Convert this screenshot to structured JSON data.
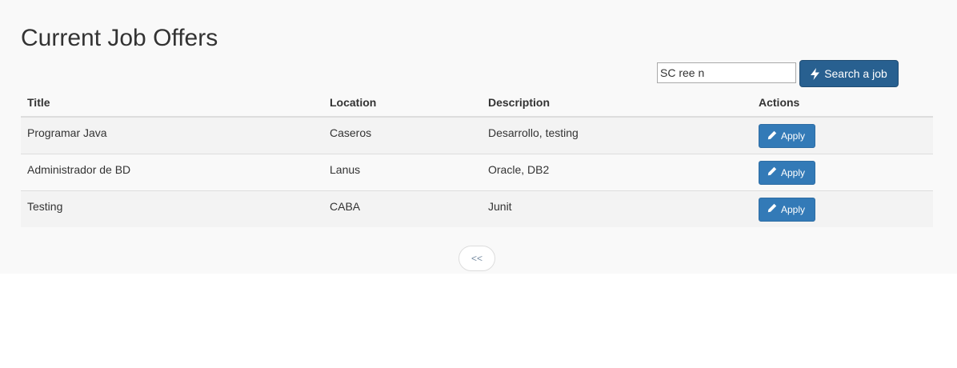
{
  "page": {
    "title": "Current Job Offers"
  },
  "search": {
    "value": "SC ree n",
    "button_label": "Search a job",
    "button_icon": "bolt-icon"
  },
  "table": {
    "headers": {
      "title": "Title",
      "location": "Location",
      "description": "Description",
      "actions": "Actions"
    },
    "rows": [
      {
        "title": "Programar Java",
        "location": "Caseros",
        "description": "Desarrollo, testing",
        "action_label": "Apply"
      },
      {
        "title": "Administrador de BD",
        "location": "Lanus",
        "description": "Oracle, DB2",
        "action_label": "Apply"
      },
      {
        "title": "Testing",
        "location": "CABA",
        "description": "Junit",
        "action_label": "Apply"
      }
    ],
    "action_icon": "pencil-icon"
  },
  "pagination": {
    "prev_label": "<<"
  },
  "colors": {
    "panel_background": "#f9f9f9",
    "search_button": "#286090",
    "apply_button": "#337ab7"
  }
}
